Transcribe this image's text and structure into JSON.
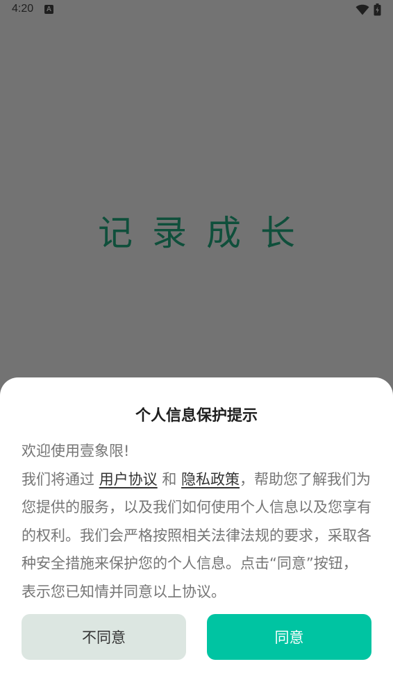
{
  "status_bar": {
    "time": "4:20",
    "notification_icon": "A",
    "icons": [
      "a-notification-icon",
      "wifi-icon",
      "battery-icon"
    ]
  },
  "splash": {
    "slogan": "记录成长"
  },
  "dialog": {
    "title": "个人信息保护提示",
    "greeting": "欢迎使用壹象限!",
    "text_before_links": "我们将通过 ",
    "user_agreement_link": "用户协议",
    "connector": " 和 ",
    "privacy_policy_link": "隐私政策",
    "text_after_links": "，帮助您了解我们为您提供的服务，以及我们如何使用个人信息以及您享有的权利。我们会严格按照相关法律法规的要求，采取各种安全措施来保护您的个人信息。点击“同意”按钮，表示您已知情并同意以上协议。",
    "disagree_label": "不同意",
    "agree_label": "同意"
  },
  "colors": {
    "overlay_background": "#737373",
    "slogan_color": "#0f4f3b",
    "agree_button": "#00c4a2",
    "disagree_button": "#dce6e1"
  }
}
